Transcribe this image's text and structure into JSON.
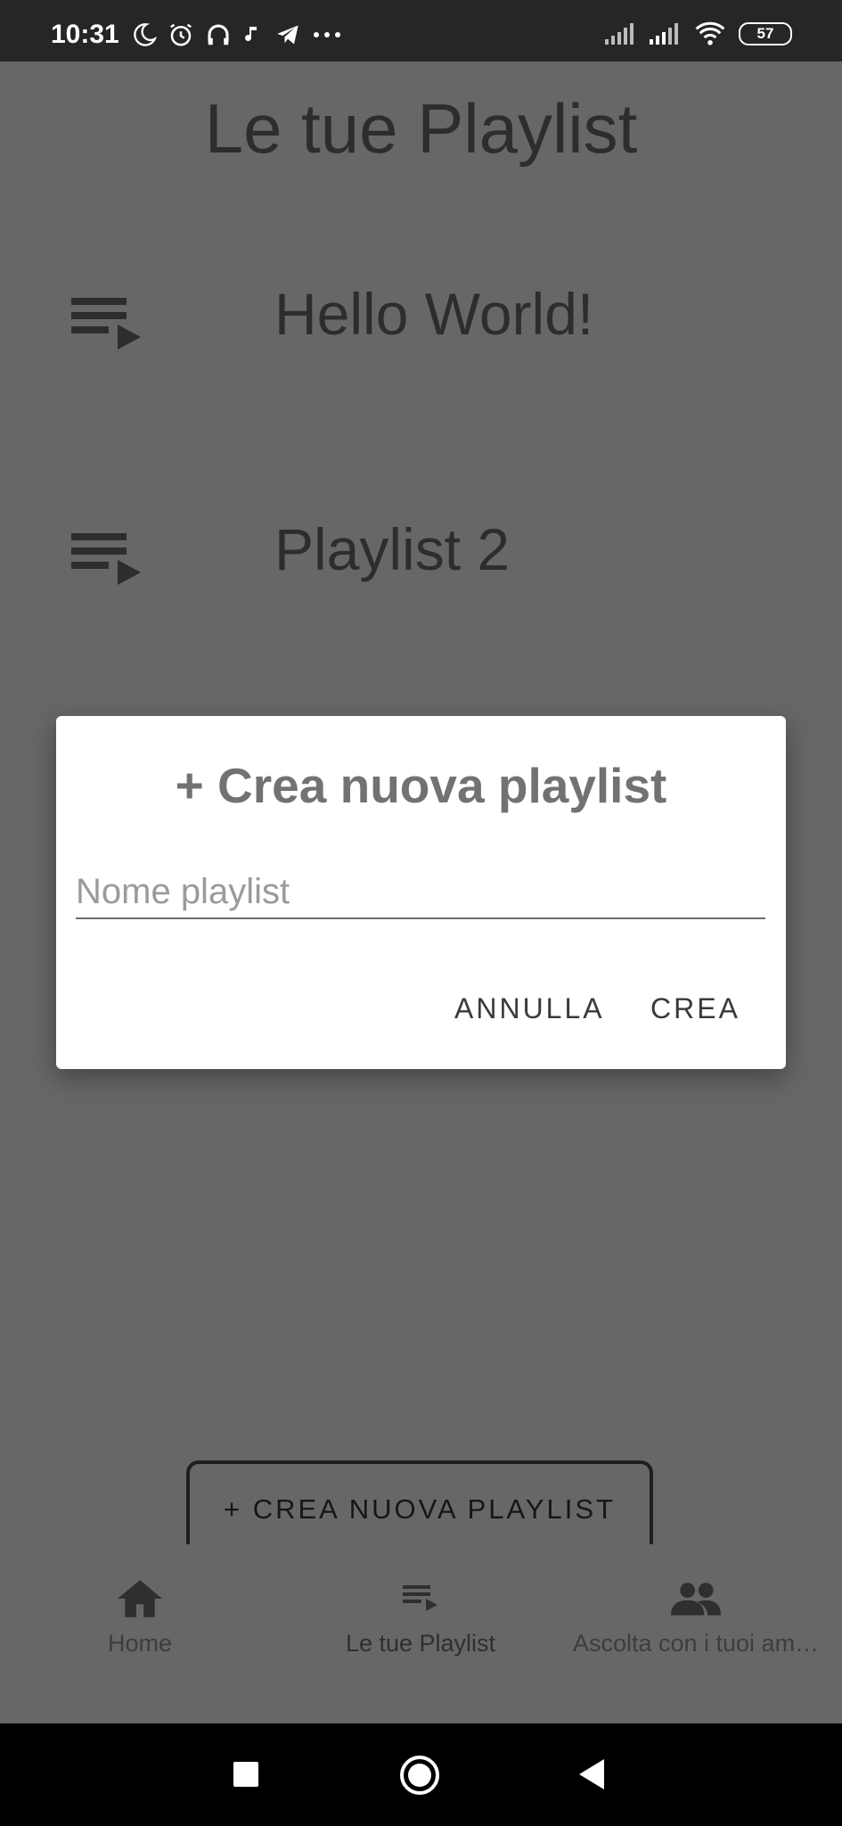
{
  "status_bar": {
    "time": "10:31",
    "battery": "57",
    "icons_left": [
      "moon-icon",
      "alarm-icon",
      "headphones-icon",
      "music-note-icon",
      "telegram-icon",
      "more-dots-icon"
    ],
    "icons_right": [
      "signal-icon",
      "signal-icon",
      "wifi-icon",
      "battery-icon"
    ]
  },
  "page": {
    "title": "Le tue Playlist"
  },
  "playlists": [
    {
      "name": "Hello World!",
      "icon": "playlist-play-icon"
    },
    {
      "name": "Playlist 2",
      "icon": "playlist-play-icon"
    }
  ],
  "create_button": {
    "label": "+ CREA NUOVA PLAYLIST"
  },
  "bottom_nav": [
    {
      "label": "Home",
      "icon": "home-icon"
    },
    {
      "label": "Le tue Playlist",
      "icon": "playlist-icon"
    },
    {
      "label": "Ascolta con i tuoi am…",
      "icon": "people-icon"
    }
  ],
  "dialog": {
    "title": "+ Crea nuova playlist",
    "input_placeholder": "Nome playlist",
    "input_value": "",
    "cancel_label": "ANNULLA",
    "confirm_label": "CREA"
  },
  "system_nav": [
    "recents-icon",
    "home-circle-icon",
    "back-icon"
  ],
  "colors": {
    "scrim": "#676767",
    "status_bar": "#262626",
    "dialog_bg": "#ffffff",
    "dialog_title": "#727272",
    "text_dark": "#2d2d2d"
  }
}
